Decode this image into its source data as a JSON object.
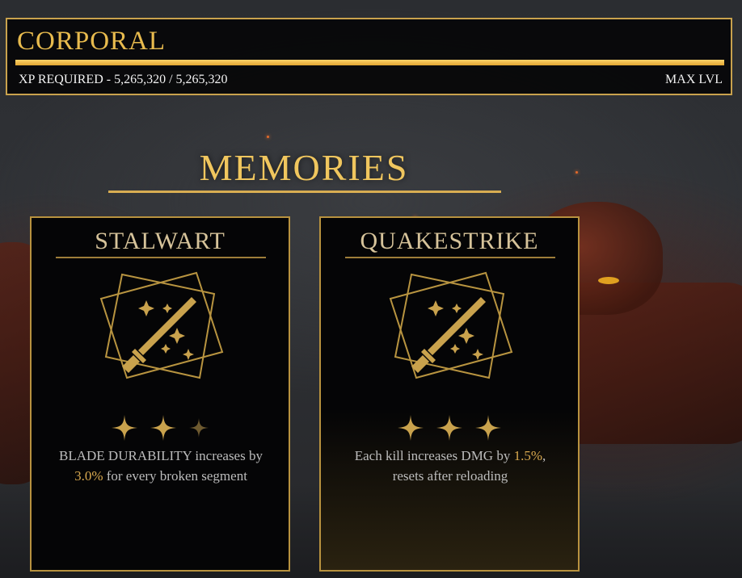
{
  "rank": {
    "title": "CORPORAL",
    "xp_label": "XP REQUIRED - 5,265,320 / 5,265,320",
    "level_label": "MAX LVL",
    "progress_fraction": 1.0
  },
  "memories": {
    "heading": "MEMORIES",
    "cards": [
      {
        "name": "STALWART",
        "icon": "sword-emblem-icon",
        "stars_filled": 2,
        "stars_total": 3,
        "desc_before": "BLADE DURABILITY increases by",
        "desc_highlight": "3.0%",
        "desc_after": " for every broken segment"
      },
      {
        "name": "QUAKESTRIKE",
        "icon": "sword-emblem-icon",
        "stars_filled": 3,
        "stars_total": 3,
        "desc_before": "Each kill increases DMG by ",
        "desc_highlight": "1.5%",
        "desc_after": ",",
        "desc_line2": "resets after reloading"
      }
    ]
  },
  "colors": {
    "gold": "#e8bb4e",
    "card_border": "#b8923f",
    "highlight": "#d8a84e"
  }
}
